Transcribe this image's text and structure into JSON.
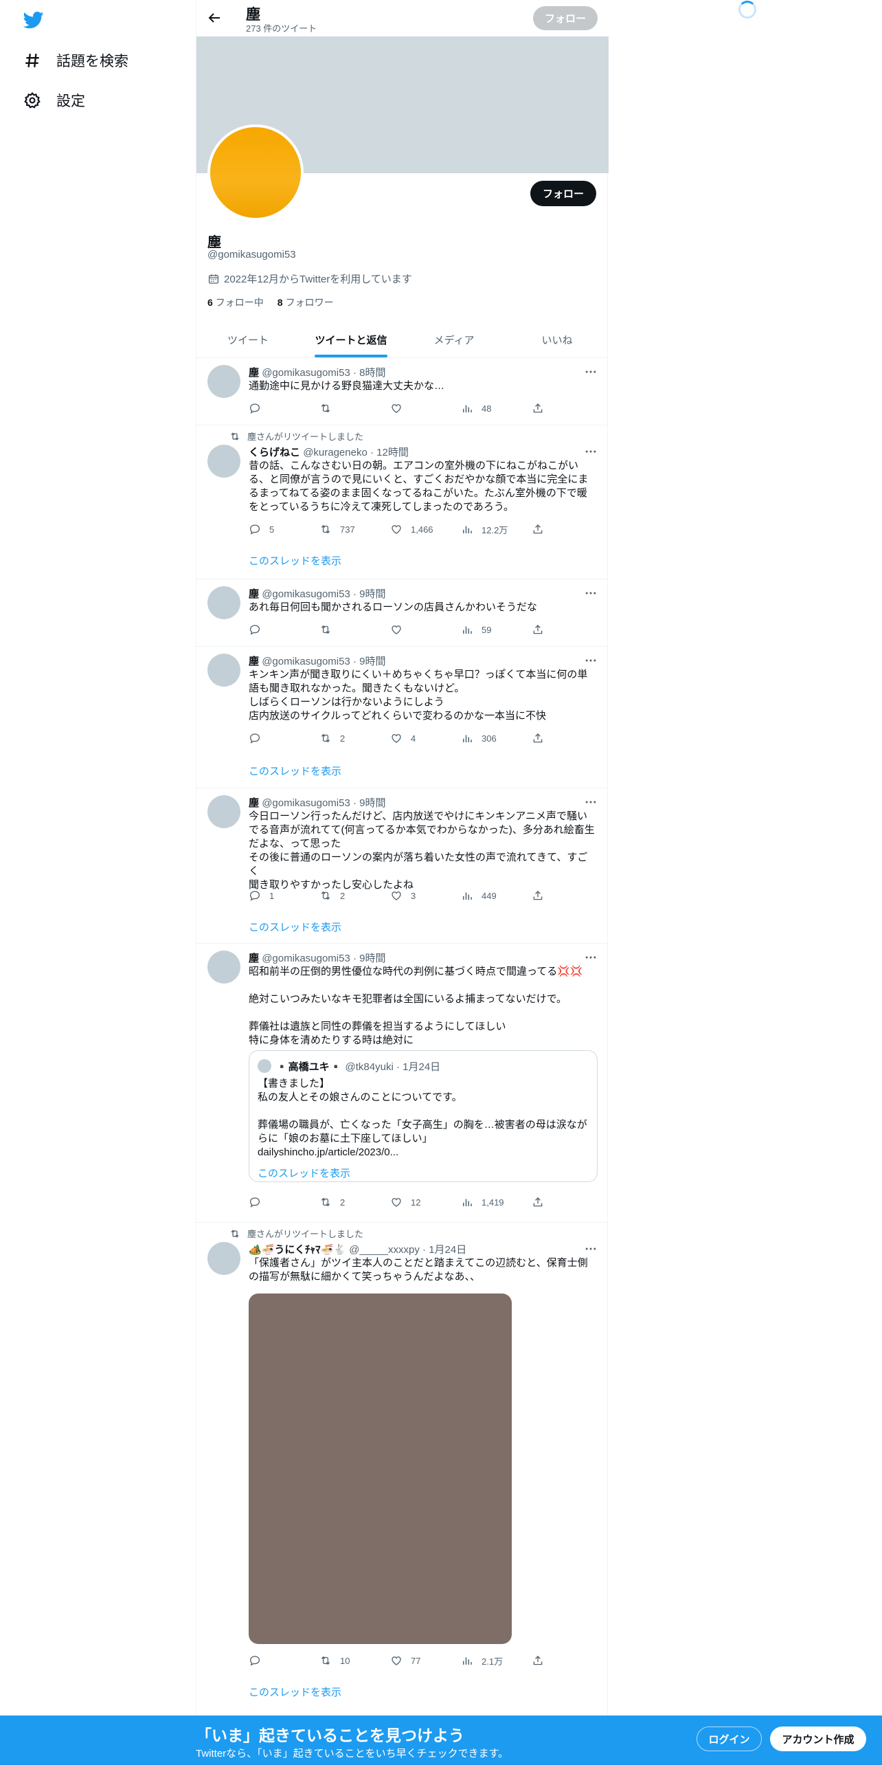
{
  "nav": {
    "logo": "twitter-bird-icon",
    "items": [
      {
        "label": "話題を検索",
        "icon": "hashtag-icon"
      },
      {
        "label": "設定",
        "icon": "gear-icon"
      }
    ]
  },
  "header": {
    "name": "塵",
    "tweet_count": "273 件のツイート",
    "follow_label": "フォロー"
  },
  "profile": {
    "follow_label": "フォロー",
    "name": "塵",
    "handle": "@gomikasugomi53",
    "joined": "2022年12月からTwitterを利用しています",
    "following_count": "6",
    "following_label": "フォロー中",
    "followers_count": "8",
    "followers_label": "フォロワー"
  },
  "tabs": [
    {
      "label": "ツイート",
      "active": false
    },
    {
      "label": "ツイートと返信",
      "active": true
    },
    {
      "label": "メディア",
      "active": false
    },
    {
      "label": "いいね",
      "active": false
    }
  ],
  "tweets": [
    {
      "name": "塵",
      "handle": "@gomikasugomi53",
      "time": "8時間",
      "lines": [
        "通勤途中に見かける野良猫達大丈夫かな…"
      ],
      "replies": "",
      "retweets": "",
      "likes": "",
      "views": "48"
    },
    {
      "retweeted_by": "塵さんがリツイートしました",
      "name": "くらげねこ",
      "handle": "@kurageneko",
      "time": "12時間",
      "lines": [
        "昔の話、こんなさむい日の朝。エアコンの室外機の下にねこがねこがい",
        "る、と同僚が言うので見にいくと、すごくおだやかな顔で本当に完全にま",
        "るまってねてる姿のまま固くなってるねこがいた。たぶん室外機の下で暖",
        "をとっているうちに冷えて凍死してしまったのであろう。"
      ],
      "replies": "5",
      "retweets": "737",
      "likes": "1,466",
      "views": "12.2万",
      "thread": "このスレッドを表示"
    },
    {
      "name": "塵",
      "handle": "@gomikasugomi53",
      "time": "9時間",
      "lines": [
        "あれ毎日何回も聞かされるローソンの店員さんかわいそうだな"
      ],
      "replies": "",
      "retweets": "",
      "likes": "",
      "views": "59"
    },
    {
      "name": "塵",
      "handle": "@gomikasugomi53",
      "time": "9時間",
      "lines": [
        "キンキン声が聞き取りにくい＋めちゃくちゃ早口？っぽくて本当に何の単",
        "語も聞き取れなかった。聞きたくもないけど。",
        "しばらくローソンは行かないようにしよう",
        "店内放送のサイクルってどれくらいで変わるのかな一本当に不快"
      ],
      "replies": "",
      "retweets": "2",
      "likes": "4",
      "views": "306",
      "thread": "このスレッドを表示"
    },
    {
      "name": "塵",
      "handle": "@gomikasugomi53",
      "time": "9時間",
      "lines": [
        "今日ローソン行ったんだけど、店内放送でやけにキンキンアニメ声で騒い",
        "でる音声が流れてて(何言ってるか本気でわからなかった)、多分あれ絵畜生",
        "だよな、って思った",
        "その後に普通のローソンの案内が落ち着いた女性の声で流れてきて、すごく",
        "聞き取りやすかったし安心したよね"
      ],
      "replies": "1",
      "retweets": "2",
      "likes": "3",
      "views": "449",
      "thread": "このスレッドを表示"
    },
    {
      "name": "塵",
      "handle": "@gomikasugomi53",
      "time": "9時間",
      "lines": [
        "昭和前半の圧倒的男性優位な時代の判例に基づく時点で間違ってる💢💢",
        "",
        "絶対こいつみたいなキモ犯罪者は全国にいるよ捕まってないだけで。",
        "",
        "葬儀社は遺族と同性の葬儀を担当するようにしてほしい",
        "特に身体を清めたりする時は絶対に"
      ],
      "quote": {
        "name": "▪️高橋ユキ▪️",
        "handle": "@tk84yuki",
        "time": "1月24日",
        "lines": [
          "【書きました】",
          "私の友人とその娘さんのことについてです。",
          "",
          "葬儀場の職員が、亡くなった「女子高生」の胸を…被害者の母は涙なが",
          "らに「娘のお墓に土下座してほしい」",
          "dailyshincho.jp/article/2023/0..."
        ],
        "thread": "このスレッドを表示"
      },
      "replies": "",
      "retweets": "2",
      "likes": "12",
      "views": "1,419"
    },
    {
      "retweeted_by": "塵さんがリツイートしました",
      "name": "🏕️🍜うにくﾁｬﾏ🍜🐇",
      "handle": "@_____xxxxpy",
      "time": "1月24日",
      "lines": [
        "「保護者さん」がツイ主本人のことだと踏まえてこの辺読むと、保育士側",
        "の描写が無駄に細かくて笑っちゃうんだよなあ、、"
      ],
      "replies": "",
      "retweets": "10",
      "likes": "77",
      "views": "2.1万",
      "thread": "このスレッドを表示"
    }
  ],
  "bottom": {
    "title": "「いま」起きていることを見つけよう",
    "subtitle": "Twitterなら、「いま」起きていることをいち早くチェックできます。",
    "login": "ログイン",
    "signup": "アカウント作成"
  },
  "colors": {
    "accent": "#1d9bf0",
    "text": "#0f1419",
    "muted": "#536471"
  }
}
